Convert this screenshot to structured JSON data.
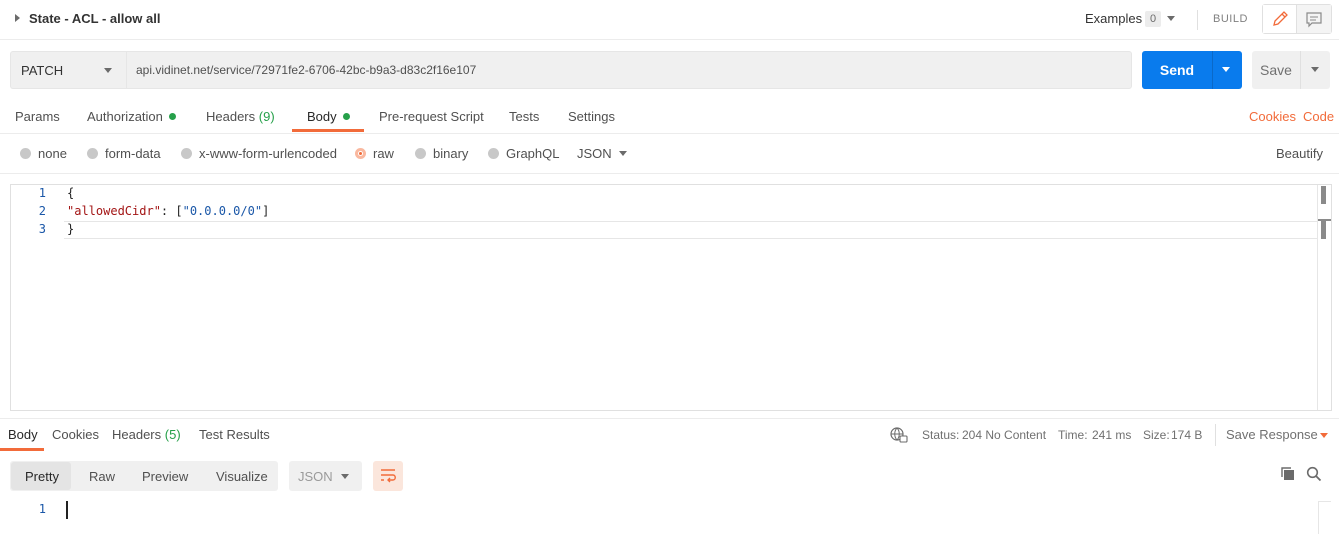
{
  "request": {
    "title": "State - ACL - allow all",
    "examples_label": "Examples",
    "examples_count": "0",
    "build_label": "BUILD",
    "method": "PATCH",
    "url": "api.vidinet.net/service/72971fe2-6706-42bc-b9a3-d83c2f16e107",
    "send_label": "Send",
    "save_label": "Save"
  },
  "request_tabs": {
    "params": "Params",
    "authorization": "Authorization",
    "headers": "Headers",
    "headers_count": "(9)",
    "body": "Body",
    "pre_request": "Pre-request Script",
    "tests": "Tests",
    "settings": "Settings",
    "cookies": "Cookies",
    "code": "Code",
    "active": "Body"
  },
  "body_types": {
    "none": "none",
    "form_data": "form-data",
    "urlencoded": "x-www-form-urlencoded",
    "raw": "raw",
    "binary": "binary",
    "graphql": "GraphQL",
    "selected": "raw",
    "format": "JSON",
    "beautify": "Beautify"
  },
  "editor": {
    "line_numbers": [
      "1",
      "2",
      "3"
    ],
    "line1": "{",
    "line2_key": "\"allowedCidr\"",
    "line2_sep": ": [",
    "line2_val": "\"0.0.0.0/0\"",
    "line2_end": "]",
    "line3": "}"
  },
  "response": {
    "tabs": {
      "body": "Body",
      "cookies": "Cookies",
      "headers": "Headers",
      "headers_count": "(5)",
      "test_results": "Test Results",
      "active": "Body"
    },
    "status_label": "Status:",
    "status_value": "204 No Content",
    "time_label": "Time:",
    "time_value": "241 ms",
    "size_label": "Size:",
    "size_value": "174 B",
    "save_response": "Save Response",
    "views": {
      "pretty": "Pretty",
      "raw": "Raw",
      "preview": "Preview",
      "visualize": "Visualize",
      "active": "Pretty"
    },
    "format": "JSON",
    "line_number": "1"
  },
  "colors": {
    "accent": "#f26b3a",
    "send": "#097bed",
    "success": "#26a04a"
  }
}
